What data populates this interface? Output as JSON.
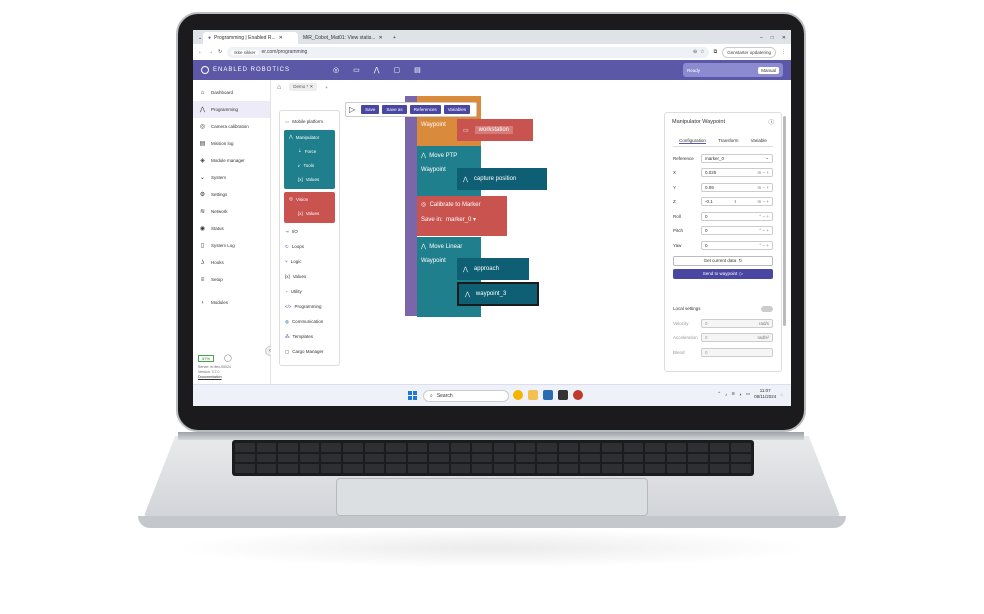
{
  "browser": {
    "tabs": [
      {
        "label": "Programming | Enabled R..."
      },
      {
        "label": "MiR_Cobot_Mat01: View statis..."
      }
    ],
    "security_label": "Ikke sikker",
    "url": "er.com/programming",
    "update_label": "Genstarter opdatering"
  },
  "header": {
    "brand": "ENABLED ROBOTICS",
    "status": "Ready",
    "mode": "Manual"
  },
  "sidebar": {
    "items": [
      {
        "label": "Dashboard",
        "icon": "home-icon"
      },
      {
        "label": "Programming",
        "icon": "robot-arm-icon"
      },
      {
        "label": "Camera calibration",
        "icon": "camera-icon"
      },
      {
        "label": "Mission log",
        "icon": "log-icon"
      },
      {
        "label": "Module manager",
        "icon": "cube-icon"
      },
      {
        "label": "System",
        "icon": "chevron-icon"
      },
      {
        "label": "Settings",
        "icon": "gear-icon"
      },
      {
        "label": "Network",
        "icon": "wifi-icon"
      },
      {
        "label": "Status",
        "icon": "status-icon"
      },
      {
        "label": "System Log",
        "icon": "file-icon"
      },
      {
        "label": "Hooks",
        "icon": "hook-icon"
      },
      {
        "label": "Setup",
        "icon": "sliders-icon"
      }
    ],
    "modules_label": "Modules",
    "battery": "57%",
    "footer_lines": [
      "Server: er-flex-00024",
      "Version: 3.7.0"
    ],
    "documentation": "Documentation"
  },
  "workspace": {
    "tab_label": "Demo *",
    "toolbar": {
      "save": "Save",
      "save_as": "Save as",
      "references": "References",
      "variables": "Variables"
    }
  },
  "palette": {
    "mobile_platform": "Mobile platform",
    "manipulator": "Manipulator",
    "manipulator_items": [
      "Force",
      "Tools",
      "Values"
    ],
    "vision": "Vision",
    "vision_items": [
      "Values"
    ],
    "items": [
      "I/O",
      "Loops",
      "Logic",
      "Values",
      "Utility",
      "Programming",
      "Communication",
      "Templates",
      "Cargo Manager"
    ]
  },
  "blocks": {
    "waypoint_top": "Waypoint",
    "workstation": "workstation",
    "move_ptp": "Move PTP",
    "waypoint_ptp": "Waypoint",
    "capture_position": "capture position",
    "calibrate": "Calibrate to Marker",
    "save_in": "Save in:",
    "marker": "marker_0",
    "move_linear": "Move Linear",
    "waypoint_linear": "Waypoint",
    "approach": "approach",
    "waypoint_3": "waypoint_3"
  },
  "panel": {
    "title": "Manipulator Waypoint",
    "tabs": [
      "Configuration",
      "Transform",
      "Variable"
    ],
    "reference_label": "Reference",
    "reference_value": "marker_0",
    "fields": [
      {
        "label": "X",
        "value": "0.025",
        "unit": "m"
      },
      {
        "label": "Y",
        "value": "0.09",
        "unit": "m"
      },
      {
        "label": "Z",
        "value": "-0.1",
        "unit": "m"
      },
      {
        "label": "Roll",
        "value": "0",
        "unit": "°"
      },
      {
        "label": "Pitch",
        "value": "0",
        "unit": "°"
      },
      {
        "label": "Yaw",
        "value": "0",
        "unit": "°"
      }
    ],
    "get_current": "Get current data",
    "send": "Send to waypoint",
    "local_settings": "Local settings",
    "velocity_label": "Velocity",
    "velocity_value": "0",
    "velocity_unit": "rad/s",
    "acceleration_label": "Acceleration",
    "acceleration_value": "0",
    "acceleration_unit": "rad/s²",
    "blend_label": "Blend",
    "blend_value": "0"
  },
  "taskbar": {
    "search": "Search",
    "time": "11:07",
    "date": "08/11/2024"
  }
}
